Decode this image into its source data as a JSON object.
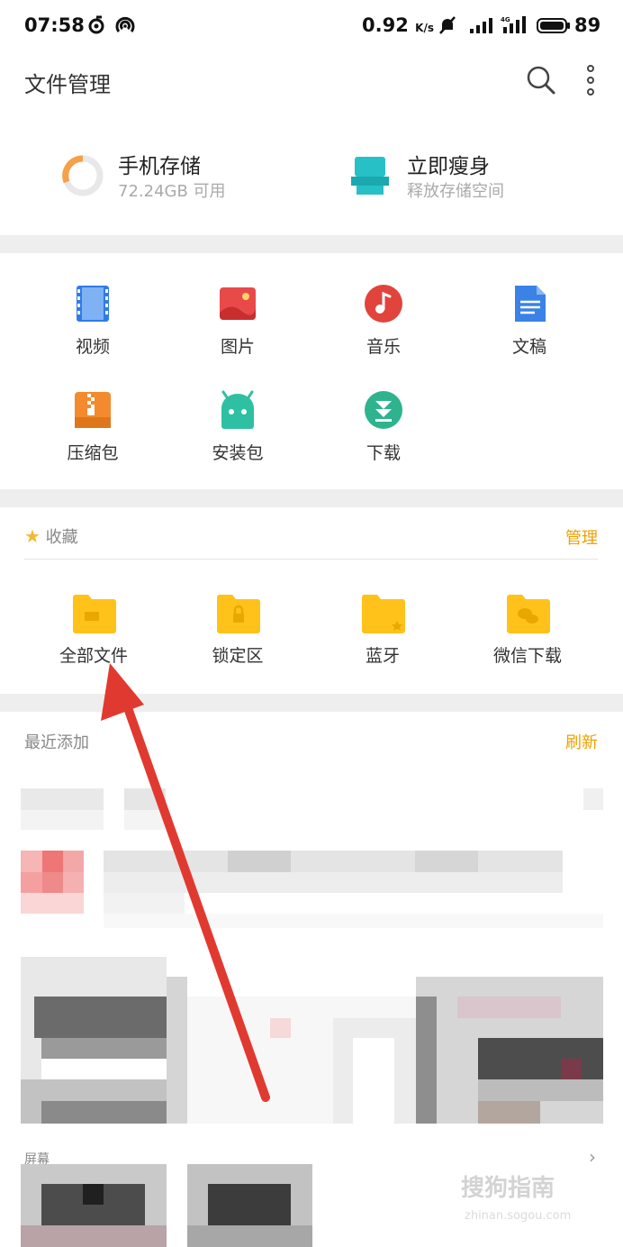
{
  "status_bar": {
    "time": "07:58",
    "speed": "0.92",
    "speed_unit": "K/s",
    "battery": "89"
  },
  "header": {
    "title": "文件管理"
  },
  "storage": {
    "phone": {
      "title": "手机存储",
      "subtitle": "72.24GB 可用"
    },
    "clean": {
      "title": "立即瘦身",
      "subtitle": "释放存储空间"
    }
  },
  "categories": [
    {
      "label": "视频",
      "icon": "video-icon"
    },
    {
      "label": "图片",
      "icon": "picture-icon"
    },
    {
      "label": "音乐",
      "icon": "music-icon"
    },
    {
      "label": "文稿",
      "icon": "document-icon"
    },
    {
      "label": "压缩包",
      "icon": "archive-icon"
    },
    {
      "label": "安装包",
      "icon": "android-package-icon"
    },
    {
      "label": "下载",
      "icon": "download-icon"
    }
  ],
  "favorites": {
    "title": "收藏",
    "manage": "管理",
    "folders": [
      {
        "label": "全部文件",
        "icon": "folder-all-files-icon"
      },
      {
        "label": "锁定区",
        "icon": "folder-lock-icon"
      },
      {
        "label": "蓝牙",
        "icon": "folder-bluetooth-icon"
      },
      {
        "label": "微信下载",
        "icon": "folder-wechat-icon"
      }
    ]
  },
  "recent": {
    "title": "最近添加",
    "refresh": "刷新",
    "screenshot_label": "屏幕"
  },
  "watermark": {
    "text": "搜狗指南",
    "sub": "zhinan.sogou.com"
  },
  "colors": {
    "accent": "#f0a000",
    "annotation_arrow": "#e03a30"
  }
}
